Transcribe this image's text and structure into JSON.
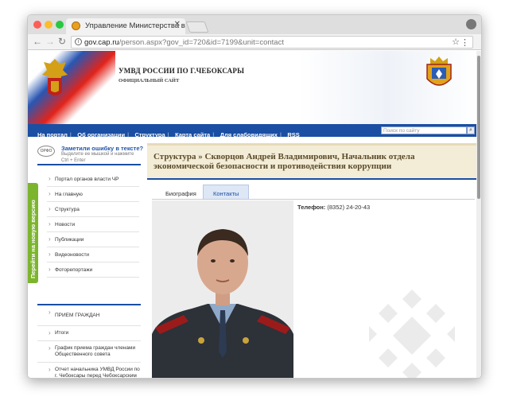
{
  "browser": {
    "tab_title": "Управление Министерства в",
    "url_domain": "gov.cap.ru",
    "url_path": "/person.aspx?gov_id=720&id=7199&unit=contact"
  },
  "header": {
    "site_name": "УМВД РОССИИ ПО Г.ЧЕБОКСАРЫ",
    "site_subtitle": "ОФИЦИАЛЬНЫЙ САЙТ"
  },
  "nav": {
    "items": [
      "На портал",
      "Об организации",
      "Структура",
      "Карта сайта",
      "Для слабовидящих",
      "RSS"
    ],
    "search_placeholder": "Поиск по сайту"
  },
  "sidebar": {
    "error_title": "Заметили ошибку в тексте?",
    "error_sub": "Выделите ее мышкой и нажмите Ctrl + Enter",
    "green_tab": "Перейти на новую версию",
    "items": [
      "Портал органов власти ЧР",
      "На главную",
      "Структура",
      "Новости",
      "Публикации",
      "Видеоновости",
      "Фоторепортажи"
    ],
    "items2": [
      "ПРИЕМ ГРАЖДАН",
      "Итоги",
      "График приема граждан членами Общественного совета",
      "Отчет начальника УМВД России по г. Чебоксары перед Чебоксарским городским Собранием депутатов"
    ]
  },
  "content": {
    "title": "Структура » Скворцов Андрей Владимирович, Начальник отдела экономической безопасности и противодействия коррупции",
    "tabs": [
      "Биография",
      "Контакты"
    ],
    "phone_label": "Телефон:",
    "phone_value": "(8352) 24-20-43"
  }
}
